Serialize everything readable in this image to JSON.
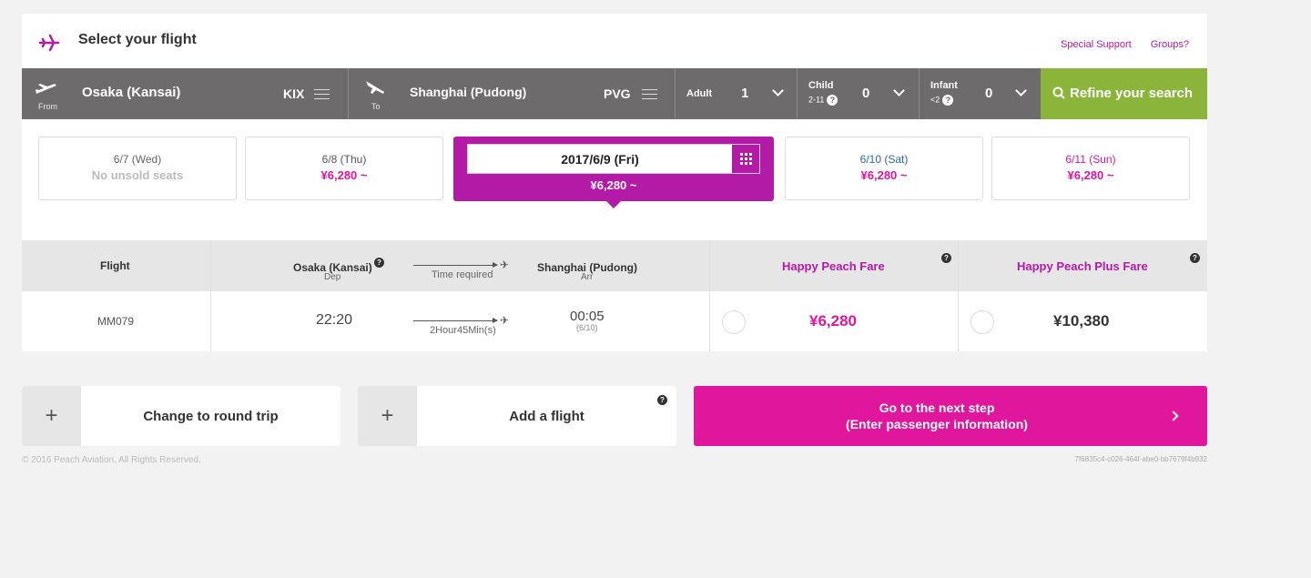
{
  "header": {
    "title": "Select your flight",
    "links": [
      "Special Support",
      "Groups?"
    ]
  },
  "search": {
    "from": {
      "label": "From",
      "city": "Osaka (Kansai)",
      "code": "KIX"
    },
    "to": {
      "label": "To",
      "city": "Shanghai (Pudong)",
      "code": "PVG"
    },
    "adult": {
      "label": "Adult",
      "value": "1"
    },
    "child": {
      "label": "Child",
      "sub": "2-11",
      "value": "0"
    },
    "infant": {
      "label": "Infant",
      "sub": "<2",
      "value": "0"
    },
    "refine_label": "Refine your search",
    "help": "?"
  },
  "dates": [
    {
      "date": "6/7 (Wed)",
      "price": "No unsold seats",
      "date_color": "#666666",
      "price_color": "#bbbbbb"
    },
    {
      "date": "6/8 (Thu)",
      "price": "¥6,280 ~",
      "date_color": "#555555",
      "price_color": "#e0169c"
    },
    {
      "date": "6/10 (Sat)",
      "price": "¥6,280 ~",
      "date_color": "#2a67b3",
      "price_color": "#e0169c"
    },
    {
      "date": "6/11 (Sun)",
      "price": "¥6,280 ~",
      "date_color": "#e0169c",
      "price_color": "#e0169c"
    }
  ],
  "selected_date": {
    "date": "2017/6/9 (Fri)",
    "price": "¥6,280 ~"
  },
  "table": {
    "headers": {
      "flight": "Flight",
      "dep": "Osaka (Kansai)",
      "dep_sub": "Dep",
      "time_required": "Time required",
      "arr": "Shanghai (Pudong)",
      "arr_sub": "Arr",
      "fare1": "Happy Peach Fare",
      "fare2": "Happy Peach Plus Fare"
    },
    "rows": [
      {
        "flight": "MM079",
        "dep_time": "22:20",
        "duration": "2Hour45Min(s)",
        "arr_time": "00:05",
        "arr_date": "(6/10)",
        "fare1": "¥6,280",
        "fare2": "¥10,380"
      }
    ]
  },
  "actions": {
    "round_trip": "Change to round trip",
    "add_flight": "Add a flight",
    "plus": "+",
    "next_line1": "Go to the next step",
    "next_line2": "(Enter passenger information)"
  },
  "footer": {
    "copyright": "© 2016 Peach Aviation. All Rights Reserved.",
    "id": "7f6835c4-c026-464f-abe0-bb7679f4b932"
  },
  "colors": {
    "brand": "#b31aa6",
    "accent": "#e0169c",
    "refine": "#8ab53a",
    "bar": "#6d6b6b"
  }
}
